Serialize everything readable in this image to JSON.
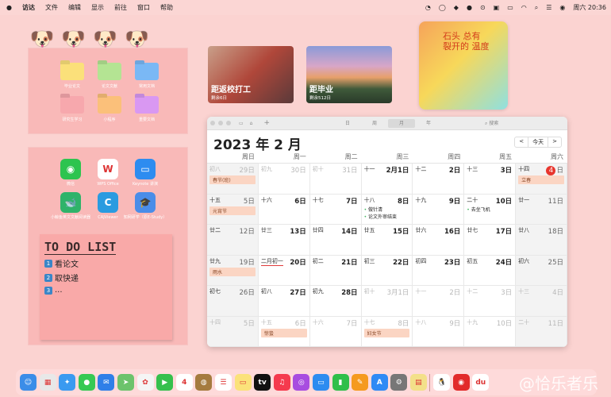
{
  "menubar": {
    "apple": "",
    "app": "访达",
    "items": [
      "文件",
      "编辑",
      "显示",
      "前往",
      "窗口",
      "帮助"
    ],
    "clock": "周六 20:36"
  },
  "folders": [
    {
      "label": "毕业论文",
      "color": "#fbe07a"
    },
    {
      "label": "论文文献",
      "color": "#b4e493"
    },
    {
      "label": "常用文档",
      "color": "#7ab8f5"
    },
    {
      "label": "研究生学习",
      "color": "#f7a8ad"
    },
    {
      "label": "小程序",
      "color": "#fbc07a"
    },
    {
      "label": "重要文档",
      "color": "#d998f2"
    }
  ],
  "apps": [
    {
      "label": "微信",
      "color": "#2dc44f",
      "glyph": "◉"
    },
    {
      "label": "WPS Office",
      "color": "#ffffff",
      "glyph": "W"
    },
    {
      "label": "Keynote 讲演",
      "color": "#2d8cf0",
      "glyph": "▭"
    },
    {
      "label": "小鲸鱼英文文献阅读器",
      "color": "#2fb36a",
      "glyph": "🐋"
    },
    {
      "label": "CAJViewer",
      "color": "#2a9be0",
      "glyph": "C"
    },
    {
      "label": "知网研学（原E-Study）",
      "color": "#4a8de8",
      "glyph": "🎓"
    }
  ],
  "todo": {
    "title": "TO DO LIST",
    "items": [
      {
        "n": "1",
        "text": "看论文"
      },
      {
        "n": "2",
        "text": "取快递"
      },
      {
        "n": "3",
        "text": "..."
      }
    ]
  },
  "countdowns": [
    {
      "title": "距返校打工",
      "sub": "剩余6日"
    },
    {
      "title": "距毕业",
      "sub": "剩余512日"
    }
  ],
  "quote": {
    "text": "石头 总有 裂开的 温度"
  },
  "calendar": {
    "views": [
      "日",
      "周",
      "月",
      "年"
    ],
    "active_view": "月",
    "search_placeholder": "搜索",
    "title": "2023 年 2 月",
    "today_label": "今天",
    "prev": "<",
    "next": ">",
    "weekdays": [
      "周日",
      "周一",
      "周二",
      "周三",
      "周四",
      "周五",
      "周六"
    ],
    "cells": [
      {
        "l": "初八",
        "d": "29日",
        "m": true,
        "ev": "春节(班)"
      },
      {
        "l": "初九",
        "d": "30日",
        "m": true
      },
      {
        "l": "初十",
        "d": "31日",
        "m": true
      },
      {
        "l": "十一",
        "d": "2月1日"
      },
      {
        "l": "十二",
        "d": "2日"
      },
      {
        "l": "十三",
        "d": "3日"
      },
      {
        "l": "十四",
        "d": "日",
        "today": "4",
        "ev": "立春"
      },
      {
        "l": "十五",
        "d": "5日",
        "ev": "元宵节"
      },
      {
        "l": "十六",
        "d": "6日"
      },
      {
        "l": "十七",
        "d": "7日"
      },
      {
        "l": "十八",
        "d": "8日",
        "list": [
          "做针清",
          "论文外审结束"
        ]
      },
      {
        "l": "十九",
        "d": "9日"
      },
      {
        "l": "二十",
        "d": "10日",
        "list": [
          "去坐飞机"
        ]
      },
      {
        "l": "廿一",
        "d": "11日"
      },
      {
        "l": "廿二",
        "d": "12日"
      },
      {
        "l": "廿三",
        "d": "13日"
      },
      {
        "l": "廿四",
        "d": "14日"
      },
      {
        "l": "廿五",
        "d": "15日"
      },
      {
        "l": "廿六",
        "d": "16日"
      },
      {
        "l": "廿七",
        "d": "17日"
      },
      {
        "l": "廿八",
        "d": "18日"
      },
      {
        "l": "廿九",
        "d": "19日",
        "ev": "雨水"
      },
      {
        "l": "二月初一",
        "d": "20日",
        "u": true
      },
      {
        "l": "初二",
        "d": "21日"
      },
      {
        "l": "初三",
        "d": "22日"
      },
      {
        "l": "初四",
        "d": "23日"
      },
      {
        "l": "初五",
        "d": "24日"
      },
      {
        "l": "初六",
        "d": "25日"
      },
      {
        "l": "初七",
        "d": "26日"
      },
      {
        "l": "初八",
        "d": "27日"
      },
      {
        "l": "初九",
        "d": "28日"
      },
      {
        "l": "初十",
        "d": "3月1日",
        "m": true
      },
      {
        "l": "十一",
        "d": "2日",
        "m": true
      },
      {
        "l": "十二",
        "d": "3日",
        "m": true
      },
      {
        "l": "十三",
        "d": "4日",
        "m": true
      },
      {
        "l": "十四",
        "d": "5日",
        "m": true
      },
      {
        "l": "十五",
        "d": "6日",
        "m": true,
        "ev": "惊蛰"
      },
      {
        "l": "十六",
        "d": "7日",
        "m": true
      },
      {
        "l": "十七",
        "d": "8日",
        "m": true,
        "ev": "妇女节"
      },
      {
        "l": "十八",
        "d": "9日",
        "m": true
      },
      {
        "l": "十九",
        "d": "10日",
        "m": true
      },
      {
        "l": "二十",
        "d": "11日",
        "m": true
      }
    ]
  },
  "dock": [
    {
      "name": "finder",
      "color": "#3b8de8",
      "g": "☺"
    },
    {
      "name": "launchpad",
      "color": "#e8e8e8",
      "g": "▦"
    },
    {
      "name": "safari",
      "color": "#3a9af0",
      "g": "✦"
    },
    {
      "name": "messages",
      "color": "#36c953",
      "g": "●"
    },
    {
      "name": "mail",
      "color": "#2f7fe8",
      "g": "✉"
    },
    {
      "name": "maps",
      "color": "#6cc36c",
      "g": "➤"
    },
    {
      "name": "photos",
      "color": "#f5f5f5",
      "g": "✿"
    },
    {
      "name": "facetime",
      "color": "#35c04d",
      "g": "▶"
    },
    {
      "name": "calendar",
      "color": "#ffffff",
      "g": "4"
    },
    {
      "name": "notes-brown",
      "color": "#a57b3f",
      "g": "◍"
    },
    {
      "name": "reminders",
      "color": "#ffffff",
      "g": "☰"
    },
    {
      "name": "notes",
      "color": "#fbe27a",
      "g": "▭"
    },
    {
      "name": "apple-tv",
      "color": "#111111",
      "g": "tv"
    },
    {
      "name": "music",
      "color": "#f53a4e",
      "g": "♫"
    },
    {
      "name": "podcasts",
      "color": "#a84de0",
      "g": "◎"
    },
    {
      "name": "keynote",
      "color": "#2d8cf0",
      "g": "▭"
    },
    {
      "name": "numbers",
      "color": "#2fbf4a",
      "g": "▮"
    },
    {
      "name": "pages",
      "color": "#f59a1f",
      "g": "✎"
    },
    {
      "name": "app-store",
      "color": "#2f8af5",
      "g": "A"
    },
    {
      "name": "system-preferences",
      "color": "#777777",
      "g": "⚙"
    },
    {
      "name": "stickies",
      "color": "#f3e089",
      "g": "▤"
    },
    {
      "name": "qq",
      "color": "#ffffff",
      "g": "🐧"
    },
    {
      "name": "netease-music",
      "color": "#e22a2a",
      "g": "◉"
    },
    {
      "name": "baidu-netdisk",
      "color": "#ffffff",
      "g": "du"
    }
  ],
  "watermark": "@恰乐者乐"
}
